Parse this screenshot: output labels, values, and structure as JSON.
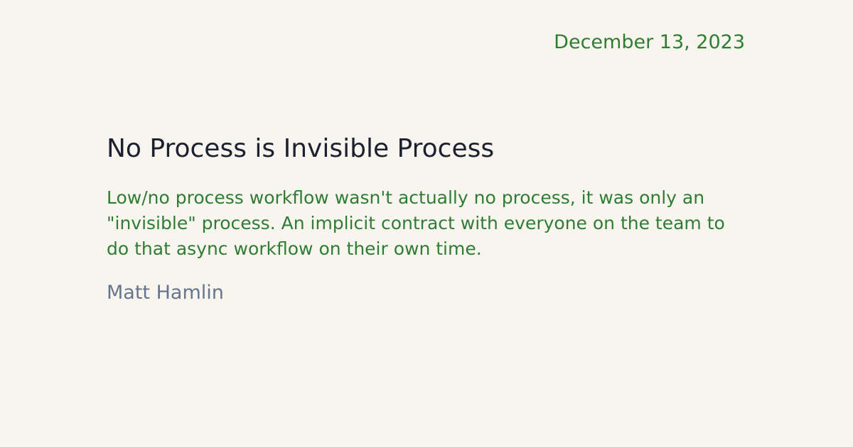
{
  "post": {
    "date": "December 13, 2023",
    "title": "No Process is Invisible Process",
    "excerpt": "Low/no process workflow wasn't actually no process, it was only an \"invisible\" process. An implicit contract with everyone on the team to do that async workflow on their own time.",
    "author": "Matt Hamlin"
  },
  "colors": {
    "background": "#f8f4ee",
    "accent_green": "#2f7d34",
    "title_text": "#1b2130",
    "author_text": "#66758f"
  }
}
